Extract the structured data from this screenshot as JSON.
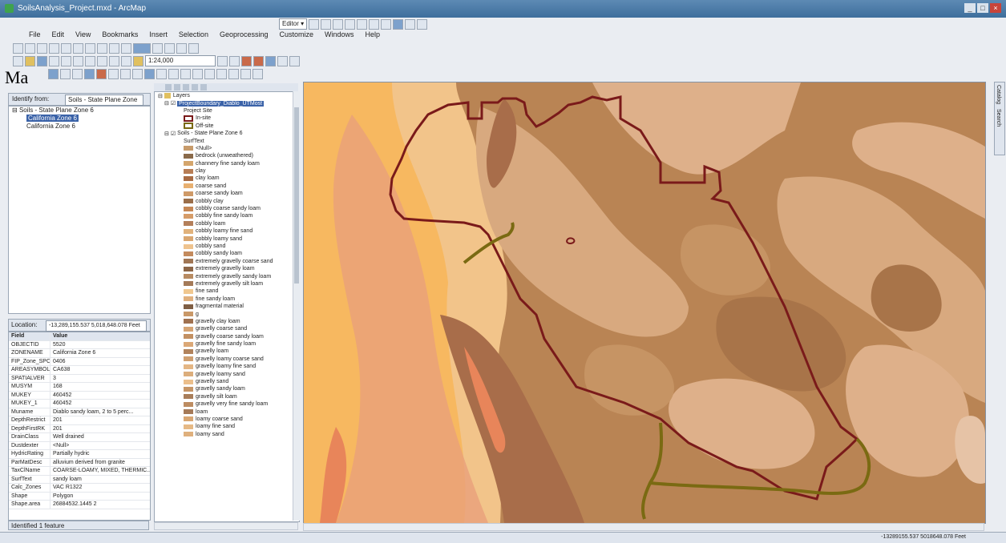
{
  "window": {
    "title": "SoilsAnalysis_Project.mxd - ArcMap"
  },
  "menu": [
    "File",
    "Edit",
    "View",
    "Bookmarks",
    "Insert",
    "Selection",
    "Geoprocessing",
    "Customize",
    "Windows",
    "Help"
  ],
  "toolbar": {
    "editor_label": "Editor ▾",
    "scale_value": "1:24,000"
  },
  "overlay_text": "Ma",
  "identify": {
    "header_label": "Identify from:",
    "dropdown_value": "Soils - State Plane Zone 6",
    "tree": [
      "Soils - State Plane Zone 6",
      "California Zone 6",
      "California Zone 6"
    ]
  },
  "location": {
    "label": "Location:",
    "value": "-13,289,155.537 5,018,648.078 Feet"
  },
  "attributes": {
    "headers": [
      "Field",
      "Value"
    ],
    "rows": [
      [
        "OBJECTID",
        "5520"
      ],
      [
        "ZONENAME",
        "California Zone 6"
      ],
      [
        "FIP_Zone_SPCS",
        "0406"
      ],
      [
        "AREASYMBOL",
        "CA638"
      ],
      [
        "SPATIALVER",
        "3"
      ],
      [
        "MUSYM",
        "168"
      ],
      [
        "MUKEY",
        "460452"
      ],
      [
        "MUKEY_1",
        "460452"
      ],
      [
        "Muname",
        "Diablo sandy loam, 2 to 5 perc..."
      ],
      [
        "DepthRestrict",
        "201"
      ],
      [
        "DepthFirstRK",
        "201"
      ],
      [
        "DrainClass",
        "Well drained"
      ],
      [
        "Dustdexter",
        "<Null>"
      ],
      [
        "HydricRating",
        "Partially hydric"
      ],
      [
        "ParMatDesc",
        "alluvium derived from granite"
      ],
      [
        "TaxClName",
        "COARSE-LOAMY, MIXED, THERMIC..."
      ],
      [
        "SurfText",
        "sandy loam"
      ],
      [
        "Calc_Zones",
        "VAC R1322"
      ],
      [
        "Shape",
        "Polygon"
      ],
      [
        "Shape.area",
        "26884532.1445 2"
      ]
    ]
  },
  "identify_status": "Identified 1 feature",
  "toc": {
    "root": "Layers",
    "boundary_layer": "ProjectBoundary_Diablo_UTMost",
    "boundary_sublabel": "Project Site",
    "boundary_symbols": [
      "In-site",
      "Off-site"
    ],
    "soils_layer": "Soils - State Plane Zone 6",
    "soils_field": "SurfText",
    "soil_classes": [
      {
        "label": "<Null>",
        "color": "#c79b6b"
      },
      {
        "label": "bedrock (unweathered)",
        "color": "#8a6a4a"
      },
      {
        "label": "channery fine sandy loam",
        "color": "#d4a56c"
      },
      {
        "label": "clay",
        "color": "#b77d55"
      },
      {
        "label": "clay loam",
        "color": "#a86b43"
      },
      {
        "label": "coarse sand",
        "color": "#e8b070"
      },
      {
        "label": "coarse sandy loam",
        "color": "#cf9a68"
      },
      {
        "label": "cobbly clay",
        "color": "#9a6e4a"
      },
      {
        "label": "cobbly coarse sandy loam",
        "color": "#c58755"
      },
      {
        "label": "cobbly fine sandy loam",
        "color": "#d69c68"
      },
      {
        "label": "cobbly loam",
        "color": "#b47f5a"
      },
      {
        "label": "cobbly loamy fine sand",
        "color": "#e1b27b"
      },
      {
        "label": "cobbly loamy sand",
        "color": "#d9a670"
      },
      {
        "label": "cobbly sand",
        "color": "#efc38e"
      },
      {
        "label": "cobbly sandy loam",
        "color": "#c48b5d"
      },
      {
        "label": "extremely gravelly coarse sand",
        "color": "#a07655"
      },
      {
        "label": "extremely gravelly loam",
        "color": "#8d6647"
      },
      {
        "label": "extremely gravelly sandy loam",
        "color": "#b88b62"
      },
      {
        "label": "extremely gravelly silt loam",
        "color": "#a47a58"
      },
      {
        "label": "fine sand",
        "color": "#f0c890"
      },
      {
        "label": "fine sandy loam",
        "color": "#e0b07e"
      },
      {
        "label": "fragmental material",
        "color": "#7f5e43"
      },
      {
        "label": "g",
        "color": "#c99868"
      },
      {
        "label": "gravelly clay loam",
        "color": "#9f7150"
      },
      {
        "label": "gravelly coarse sand",
        "color": "#d5a474"
      },
      {
        "label": "gravelly coarse sandy loam",
        "color": "#c39062"
      },
      {
        "label": "gravelly fine sandy loam",
        "color": "#dba877"
      },
      {
        "label": "gravelly loam",
        "color": "#b1835c"
      },
      {
        "label": "gravelly loamy coarse sand",
        "color": "#cf9f70"
      },
      {
        "label": "gravelly loamy fine sand",
        "color": "#e4b684"
      },
      {
        "label": "gravelly loamy sand",
        "color": "#dcae7c"
      },
      {
        "label": "gravelly sand",
        "color": "#ebbf8c"
      },
      {
        "label": "gravelly sandy loam",
        "color": "#c69566"
      },
      {
        "label": "gravelly silt loam",
        "color": "#a97e5a"
      },
      {
        "label": "gravelly very fine sandy loam",
        "color": "#bd8d62"
      },
      {
        "label": "loam",
        "color": "#a57a58"
      },
      {
        "label": "loamy coarse sand",
        "color": "#d8a672"
      },
      {
        "label": "loamy fine sand",
        "color": "#e6b985"
      },
      {
        "label": "loamy sand",
        "color": "#dfb07d"
      }
    ]
  },
  "status_bar": {
    "coords": "-13289155.537  5018648.078 Feet"
  },
  "dock_tabs": [
    "Catalog",
    "Search"
  ],
  "colors": {
    "boundary": "#7a1a1a",
    "road": "#7a6a12",
    "map_bg": "#f7b860"
  }
}
